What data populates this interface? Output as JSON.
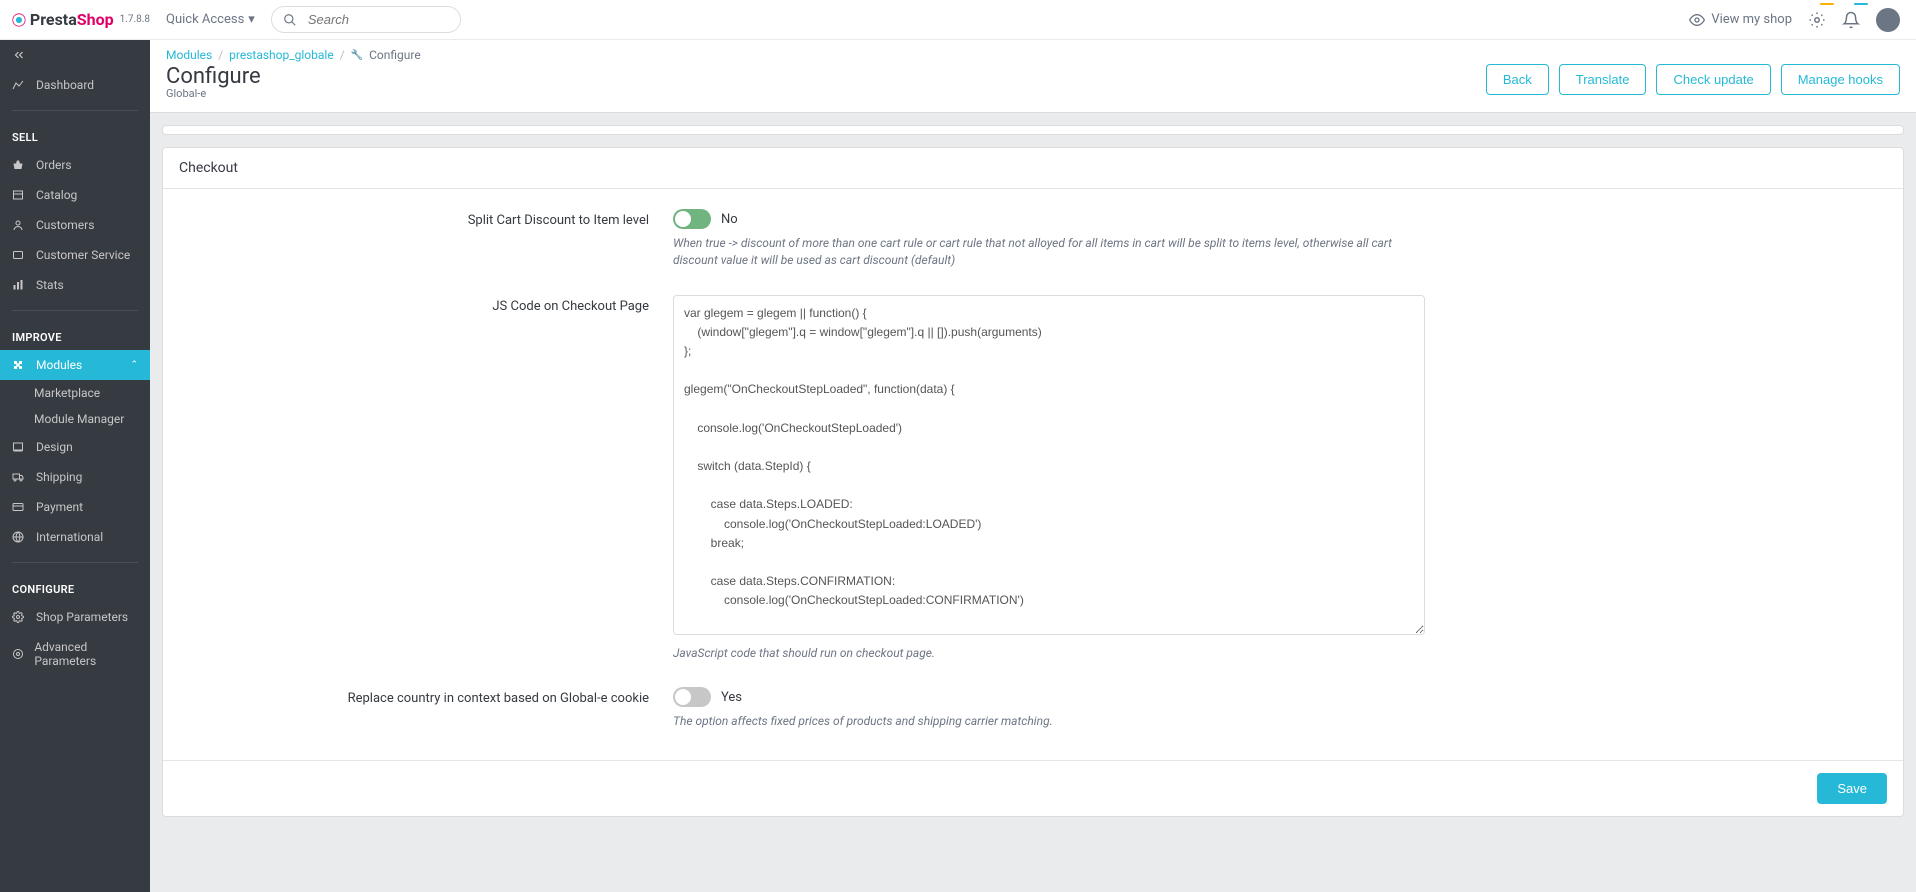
{
  "brand": {
    "presta": "Presta",
    "shop": "Shop",
    "version": "1.7.8.8"
  },
  "header": {
    "quick_access": "Quick Access",
    "search_placeholder": "Search",
    "view_shop": "View my shop"
  },
  "sidebar": {
    "dashboard": "Dashboard",
    "sections": {
      "sell": "SELL",
      "improve": "IMPROVE",
      "configure": "CONFIGURE"
    },
    "items": {
      "orders": "Orders",
      "catalog": "Catalog",
      "customers": "Customers",
      "customer_service": "Customer Service",
      "stats": "Stats",
      "modules": "Modules",
      "marketplace": "Marketplace",
      "module_manager": "Module Manager",
      "design": "Design",
      "shipping": "Shipping",
      "payment": "Payment",
      "international": "International",
      "shop_parameters": "Shop Parameters",
      "advanced_parameters": "Advanced Parameters"
    }
  },
  "breadcrumb": {
    "modules": "Modules",
    "module": "prestashop_globale",
    "configure": "Configure"
  },
  "page": {
    "title": "Configure",
    "subtitle": "Global-e",
    "actions": {
      "back": "Back",
      "translate": "Translate",
      "check_update": "Check update",
      "manage_hooks": "Manage hooks"
    }
  },
  "panel": {
    "title": "Checkout",
    "save": "Save",
    "fields": {
      "split_cart": {
        "label": "Split Cart Discount to Item level",
        "value": "No",
        "help": "When true -> discount of more than one cart rule or cart rule that not alloyed for all items in cart will be split to items level, otherwise all cart discount value it will be used as cart discount (default)"
      },
      "js_code": {
        "label": "JS Code on Checkout Page",
        "value": "var glegem = glegem || function() {\n    (window[\"glegem\"].q = window[\"glegem\"].q || []).push(arguments)\n};\n\nglegem(\"OnCheckoutStepLoaded\", function(data) {\n\n    console.log('OnCheckoutStepLoaded')\n\n    switch (data.StepId) {\n\n        case data.Steps.LOADED:\n            console.log('OnCheckoutStepLoaded:LOADED')\n        break;\n\n        case data.Steps.CONFIRMATION:\n            console.log('OnCheckoutStepLoaded:CONFIRMATION')\n\n            if (data.IsSuccess && !data.IsPageReload) {\n                console.log('OnCheckoutStepLoaded:IsSuccess')\n                // send some statistic\n            }\n        break;\n    }\n});",
        "help": "JavaScript code that should run on checkout page."
      },
      "replace_country": {
        "label": "Replace country in context based on Global-e cookie",
        "value": "Yes",
        "help": "The option affects fixed prices of products and shipping carrier matching."
      }
    }
  }
}
